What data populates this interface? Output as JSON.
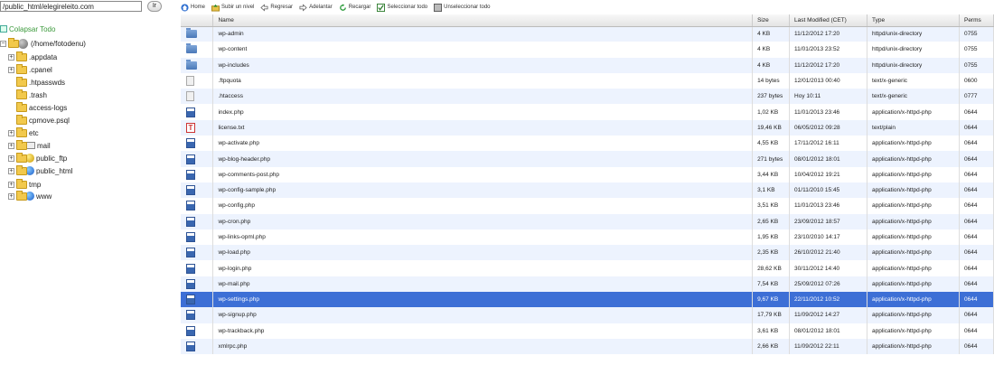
{
  "tree": {
    "path_value": "/public_html/elegireleito.com",
    "go_label": "Ir",
    "collapse_label": "Colapsar Todo",
    "items": [
      {
        "label": "(/home/fotodenu)"
      },
      {
        "label": ".appdata"
      },
      {
        "label": ".cpanel"
      },
      {
        "label": ".htpasswds"
      },
      {
        "label": ".trash"
      },
      {
        "label": "access-logs"
      },
      {
        "label": "cpmove.psql"
      },
      {
        "label": "etc"
      },
      {
        "label": "mail"
      },
      {
        "label": "public_ftp"
      },
      {
        "label": "public_html"
      },
      {
        "label": "tmp"
      },
      {
        "label": "www"
      }
    ]
  },
  "toolbar": {
    "home": "Home",
    "up": "Subir un nivel",
    "back": "Regresar",
    "forward": "Adelantar",
    "reload": "Recargar",
    "select_all": "Seleccionar todo",
    "unselect_all": "Unseleccionar todo"
  },
  "table": {
    "headers": {
      "name": "Name",
      "size": "Size",
      "modified": "Last Modified (CET)",
      "type": "Type",
      "perms": "Perms"
    },
    "rows": [
      {
        "icon": "folder-icon",
        "name": "wp-admin",
        "size": "4 KB",
        "modified": "11/12/2012 17:20",
        "type": "httpd/unix-directory",
        "perms": "0755"
      },
      {
        "icon": "folder-icon",
        "name": "wp-content",
        "size": "4 KB",
        "modified": "11/01/2013 23:52",
        "type": "httpd/unix-directory",
        "perms": "0755"
      },
      {
        "icon": "folder-icon",
        "name": "wp-includes",
        "size": "4 KB",
        "modified": "11/12/2012 17:20",
        "type": "httpd/unix-directory",
        "perms": "0755"
      },
      {
        "icon": "generic-file-icon",
        "name": ".ftpquota",
        "size": "14 bytes",
        "modified": "12/01/2013 00:40",
        "type": "text/x-generic",
        "perms": "0600"
      },
      {
        "icon": "generic-file-icon",
        "name": ".htaccess",
        "size": "237 bytes",
        "modified": "Hoy 10:11",
        "type": "text/x-generic",
        "perms": "0777"
      },
      {
        "icon": "php-file-icon",
        "name": "index.php",
        "size": "1,02 KB",
        "modified": "11/01/2013 23:46",
        "type": "application/x-httpd-php",
        "perms": "0644"
      },
      {
        "icon": "text-file-icon",
        "name": "license.txt",
        "size": "19,46 KB",
        "modified": "06/05/2012 09:28",
        "type": "text/plain",
        "perms": "0644"
      },
      {
        "icon": "php-file-icon",
        "name": "wp-activate.php",
        "size": "4,55 KB",
        "modified": "17/11/2012 16:11",
        "type": "application/x-httpd-php",
        "perms": "0644"
      },
      {
        "icon": "php-file-icon",
        "name": "wp-blog-header.php",
        "size": "271 bytes",
        "modified": "08/01/2012 18:01",
        "type": "application/x-httpd-php",
        "perms": "0644"
      },
      {
        "icon": "php-file-icon",
        "name": "wp-comments-post.php",
        "size": "3,44 KB",
        "modified": "10/04/2012 19:21",
        "type": "application/x-httpd-php",
        "perms": "0644"
      },
      {
        "icon": "php-file-icon",
        "name": "wp-config-sample.php",
        "size": "3,1 KB",
        "modified": "01/11/2010 15:45",
        "type": "application/x-httpd-php",
        "perms": "0644"
      },
      {
        "icon": "php-file-icon",
        "name": "wp-config.php",
        "size": "3,51 KB",
        "modified": "11/01/2013 23:46",
        "type": "application/x-httpd-php",
        "perms": "0644"
      },
      {
        "icon": "php-file-icon",
        "name": "wp-cron.php",
        "size": "2,65 KB",
        "modified": "23/09/2012 18:57",
        "type": "application/x-httpd-php",
        "perms": "0644"
      },
      {
        "icon": "php-file-icon",
        "name": "wp-links-opml.php",
        "size": "1,95 KB",
        "modified": "23/10/2010 14:17",
        "type": "application/x-httpd-php",
        "perms": "0644"
      },
      {
        "icon": "php-file-icon",
        "name": "wp-load.php",
        "size": "2,35 KB",
        "modified": "26/10/2012 21:40",
        "type": "application/x-httpd-php",
        "perms": "0644"
      },
      {
        "icon": "php-file-icon",
        "name": "wp-login.php",
        "size": "28,62 KB",
        "modified": "30/11/2012 14:40",
        "type": "application/x-httpd-php",
        "perms": "0644"
      },
      {
        "icon": "php-file-icon",
        "name": "wp-mail.php",
        "size": "7,54 KB",
        "modified": "25/09/2012 07:26",
        "type": "application/x-httpd-php",
        "perms": "0644"
      },
      {
        "icon": "php-file-icon",
        "name": "wp-settings.php",
        "size": "9,67 KB",
        "modified": "22/11/2012 10:52",
        "type": "application/x-httpd-php",
        "perms": "0644",
        "selected": true
      },
      {
        "icon": "php-file-icon",
        "name": "wp-signup.php",
        "size": "17,79 KB",
        "modified": "11/09/2012 14:27",
        "type": "application/x-httpd-php",
        "perms": "0644"
      },
      {
        "icon": "php-file-icon",
        "name": "wp-trackback.php",
        "size": "3,61 KB",
        "modified": "08/01/2012 18:01",
        "type": "application/x-httpd-php",
        "perms": "0644"
      },
      {
        "icon": "php-file-icon",
        "name": "xmlrpc.php",
        "size": "2,66 KB",
        "modified": "11/09/2012 22:11",
        "type": "application/x-httpd-php",
        "perms": "0644"
      }
    ]
  },
  "colors": {
    "selected_row": "#3d6fd6",
    "alt_row": "#edf3fe",
    "collapse_link": "#3c9a3c"
  }
}
